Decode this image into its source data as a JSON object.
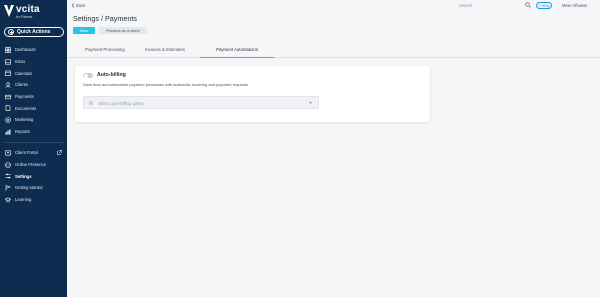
{
  "brand": {
    "name": "vcita",
    "subtitle": "for Fitness"
  },
  "quick_actions": {
    "label": "Quick Actions"
  },
  "sidebar": {
    "items": [
      {
        "label": "Dashboard",
        "icon": "dashboard-icon"
      },
      {
        "label": "Inbox",
        "icon": "inbox-icon"
      },
      {
        "label": "Calendar",
        "icon": "calendar-icon"
      },
      {
        "label": "Clients",
        "icon": "clients-icon"
      },
      {
        "label": "Payments",
        "icon": "payments-icon"
      },
      {
        "label": "Documents",
        "icon": "documents-icon"
      },
      {
        "label": "Marketing",
        "icon": "marketing-icon"
      },
      {
        "label": "Reports",
        "icon": "reports-icon"
      }
    ],
    "secondary": [
      {
        "label": "Client Portal",
        "icon": "client-portal-icon"
      },
      {
        "label": "Online Presence",
        "icon": "online-presence-icon"
      },
      {
        "label": "Settings",
        "icon": "settings-icon",
        "active": true
      },
      {
        "label": "Getting started",
        "icon": "getting-started-icon"
      },
      {
        "label": "Learning",
        "icon": "learning-icon"
      }
    ]
  },
  "topbar": {
    "back_label": "Back",
    "search_placeholder": "Search",
    "help_label": "Help",
    "user_name": "Meer Alhassn"
  },
  "page": {
    "title": "Settings / Payments",
    "save_label": "Save",
    "preview_label": "Preview as a client"
  },
  "tabs": [
    {
      "label": "Payment Processing"
    },
    {
      "label": "Invoices & Estimates"
    },
    {
      "label": "Payment Automations",
      "active": true
    }
  ],
  "auto_billing": {
    "title": "Auto-billing",
    "description": "Save time and streamline payment processes with automatic invoicing and payment requests.",
    "select_placeholder": "Select auto-billing option",
    "enabled": false
  },
  "colors": {
    "sidebar_bg": "#0d2c4f",
    "accent": "#27c4e6",
    "tab_active": "#f07a3c"
  }
}
